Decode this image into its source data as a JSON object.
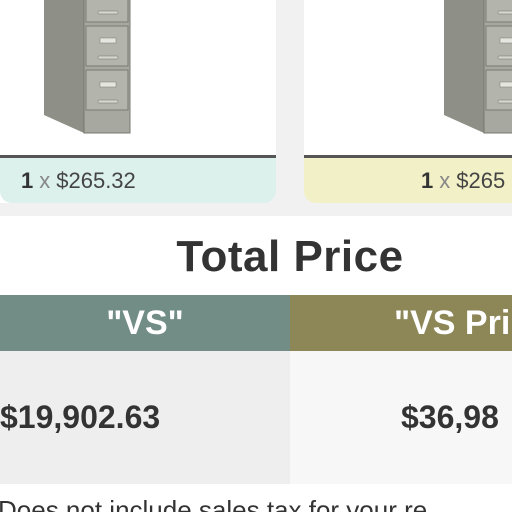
{
  "products": [
    {
      "quantity": "1",
      "times": "x",
      "price": "$265.32",
      "accent": "#dcf0ec"
    },
    {
      "quantity": "1",
      "times": "x",
      "price": "$265",
      "accent": "#f2f0c6"
    }
  ],
  "total": {
    "title": "Total Price",
    "columns": [
      {
        "label": "\"VS\"",
        "value": "$19,902.63",
        "color": "#728c86"
      },
      {
        "label": "\"VS Pri",
        "value": "$36,98",
        "color": "#8d8758"
      }
    ]
  },
  "footnote": "Does not include sales tax for your re",
  "icons": [
    "filing-cabinet-icon"
  ]
}
